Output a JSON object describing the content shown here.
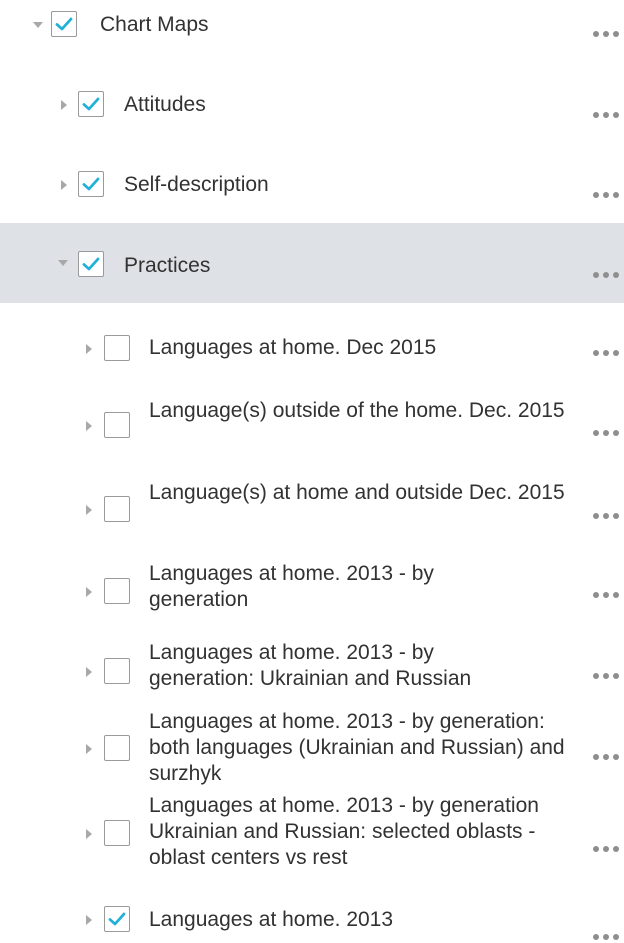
{
  "colors": {
    "check_accent": "#21b0d9",
    "selected_row_bg": "#dee2e6",
    "text": "#323232",
    "caret": "#a8a8a8",
    "ellipsis": "#8e8e8e"
  },
  "tree": {
    "root": {
      "label": "Chart Maps",
      "checked": true,
      "expanded": true,
      "options_icon": "ellipsis-icon"
    },
    "groups": [
      {
        "label": "Attitudes",
        "checked": true,
        "expanded": false
      },
      {
        "label": "Self-description",
        "checked": true,
        "expanded": false
      },
      {
        "label": "Practices",
        "checked": true,
        "expanded": true,
        "selected": true
      }
    ],
    "practices_items": [
      {
        "label": "Languages at home. Dec 2015",
        "checked": false
      },
      {
        "label": "Language(s) outside of the home. Dec. 2015",
        "checked": false
      },
      {
        "label": "Language(s) at home and outside Dec. 2015",
        "checked": false
      },
      {
        "label": "Languages at home. 2013 - by generation",
        "checked": false
      },
      {
        "label": "Languages at home. 2013 - by generation: Ukrainian and Russian",
        "checked": false
      },
      {
        "label": "Languages at home. 2013 - by generation: both languages (Ukrainian and Russian) and surzhyk",
        "checked": false
      },
      {
        "label": "Languages at home. 2013 - by generation Ukrainian and Russian: selected oblasts - oblast centers vs rest",
        "checked": false
      },
      {
        "label": "Languages at home. 2013",
        "checked": true
      }
    ]
  }
}
